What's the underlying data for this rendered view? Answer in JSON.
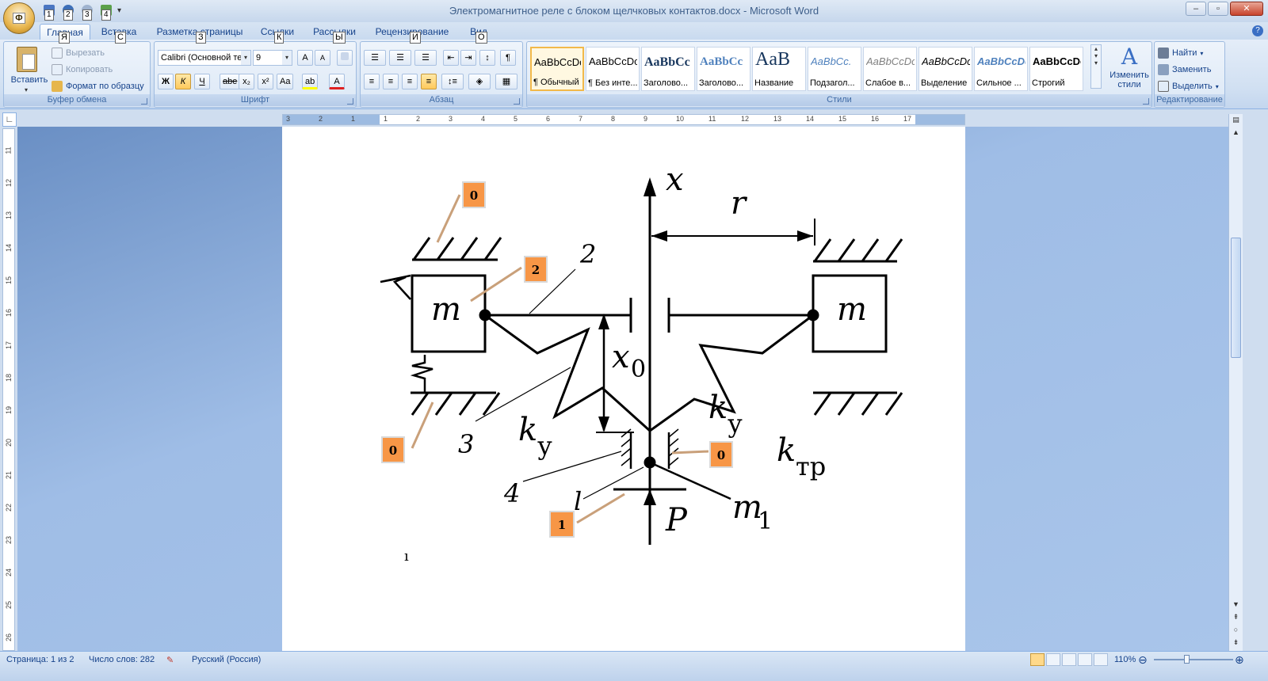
{
  "window": {
    "title": "Электромагнитное реле с блоком щелчковых контактов.docx - Microsoft Word",
    "office_keytip": "Ф",
    "qat_keytips": [
      "1",
      "2",
      "3",
      "4"
    ],
    "minimize": "–",
    "maximize": "▫",
    "close": "✕"
  },
  "tabs": [
    {
      "label": "Главная",
      "keytip": "Я"
    },
    {
      "label": "Вставка",
      "keytip": "С"
    },
    {
      "label": "Разметка страницы",
      "keytip": "З"
    },
    {
      "label": "Ссылки",
      "keytip": "К"
    },
    {
      "label": "Рассылки",
      "keytip": "Ы"
    },
    {
      "label": "Рецензирование",
      "keytip": "И"
    },
    {
      "label": "Вид",
      "keytip": "О"
    }
  ],
  "clipboard": {
    "paste": "Вставить",
    "cut": "Вырезать",
    "copy": "Копировать",
    "format_painter": "Формат по образцу",
    "label": "Буфер обмена"
  },
  "font": {
    "name": "Calibri (Основной те",
    "size": "9",
    "grow": "A",
    "shrink": "A",
    "bold": "Ж",
    "italic": "К",
    "underline": "Ч",
    "strike": "abe",
    "subscript": "x₂",
    "superscript": "x²",
    "case": "Aa",
    "highlight": "ab",
    "color": "A",
    "label": "Шрифт"
  },
  "paragraph": {
    "pilcrow": "¶",
    "label": "Абзац"
  },
  "styles": {
    "items": [
      {
        "sample": "AaBbCcDc",
        "name": "¶ Обычный"
      },
      {
        "sample": "AaBbCcDc",
        "name": "¶ Без инте..."
      },
      {
        "sample": "AaBbCc",
        "name": "Заголово..."
      },
      {
        "sample": "AaBbCc",
        "name": "Заголово..."
      },
      {
        "sample": "AaB",
        "name": "Название"
      },
      {
        "sample": "AaBbCc.",
        "name": "Подзагол..."
      },
      {
        "sample": "AaBbCcDc",
        "name": "Слабое в..."
      },
      {
        "sample": "AaBbCcDc",
        "name": "Выделение"
      },
      {
        "sample": "AaBbCcDc",
        "name": "Сильное ..."
      },
      {
        "sample": "AaBbCcDc",
        "name": "Строгий"
      }
    ],
    "change_styles_1": "Изменить",
    "change_styles_2": "стили",
    "label": "Стили"
  },
  "editing": {
    "find": "Найти",
    "replace": "Заменить",
    "select": "Выделить",
    "label": "Редактирование"
  },
  "ruler": {
    "h_labels": [
      "3",
      "2",
      "1",
      "1",
      "2",
      "3",
      "4",
      "5",
      "6",
      "7",
      "8",
      "9",
      "10",
      "11",
      "12",
      "13",
      "14",
      "15",
      "16",
      "17"
    ],
    "v_labels": [
      "11",
      "12",
      "13",
      "14",
      "15",
      "16",
      "17",
      "18",
      "19",
      "20",
      "21",
      "22",
      "23",
      "24",
      "25",
      "26"
    ]
  },
  "figure": {
    "x_axis": "x",
    "r": "r",
    "m_left": "m",
    "m_right": "m",
    "x0_base": "x",
    "x0_sub": "0",
    "ky_left_base": "k",
    "ky_left_sub": "у",
    "ky_right_base": "k",
    "ky_right_sub": "у",
    "ktr_base": "k",
    "ktr_sub": "тр",
    "m1_base": "m",
    "m1_sub": "1",
    "p": "P",
    "num_2": "2",
    "num_3": "3",
    "num_4": "4",
    "num_l": "l",
    "cursor_mark": "ı",
    "callouts": [
      "0",
      "2",
      "0",
      "0",
      "1"
    ],
    "colors": {
      "callout_fill": "#f79646",
      "leader": "#c9a07a"
    }
  },
  "status": {
    "page": "Страница: 1 из 2",
    "words": "Число слов: 282",
    "language": "Русский (Россия)",
    "zoom": "110%"
  }
}
